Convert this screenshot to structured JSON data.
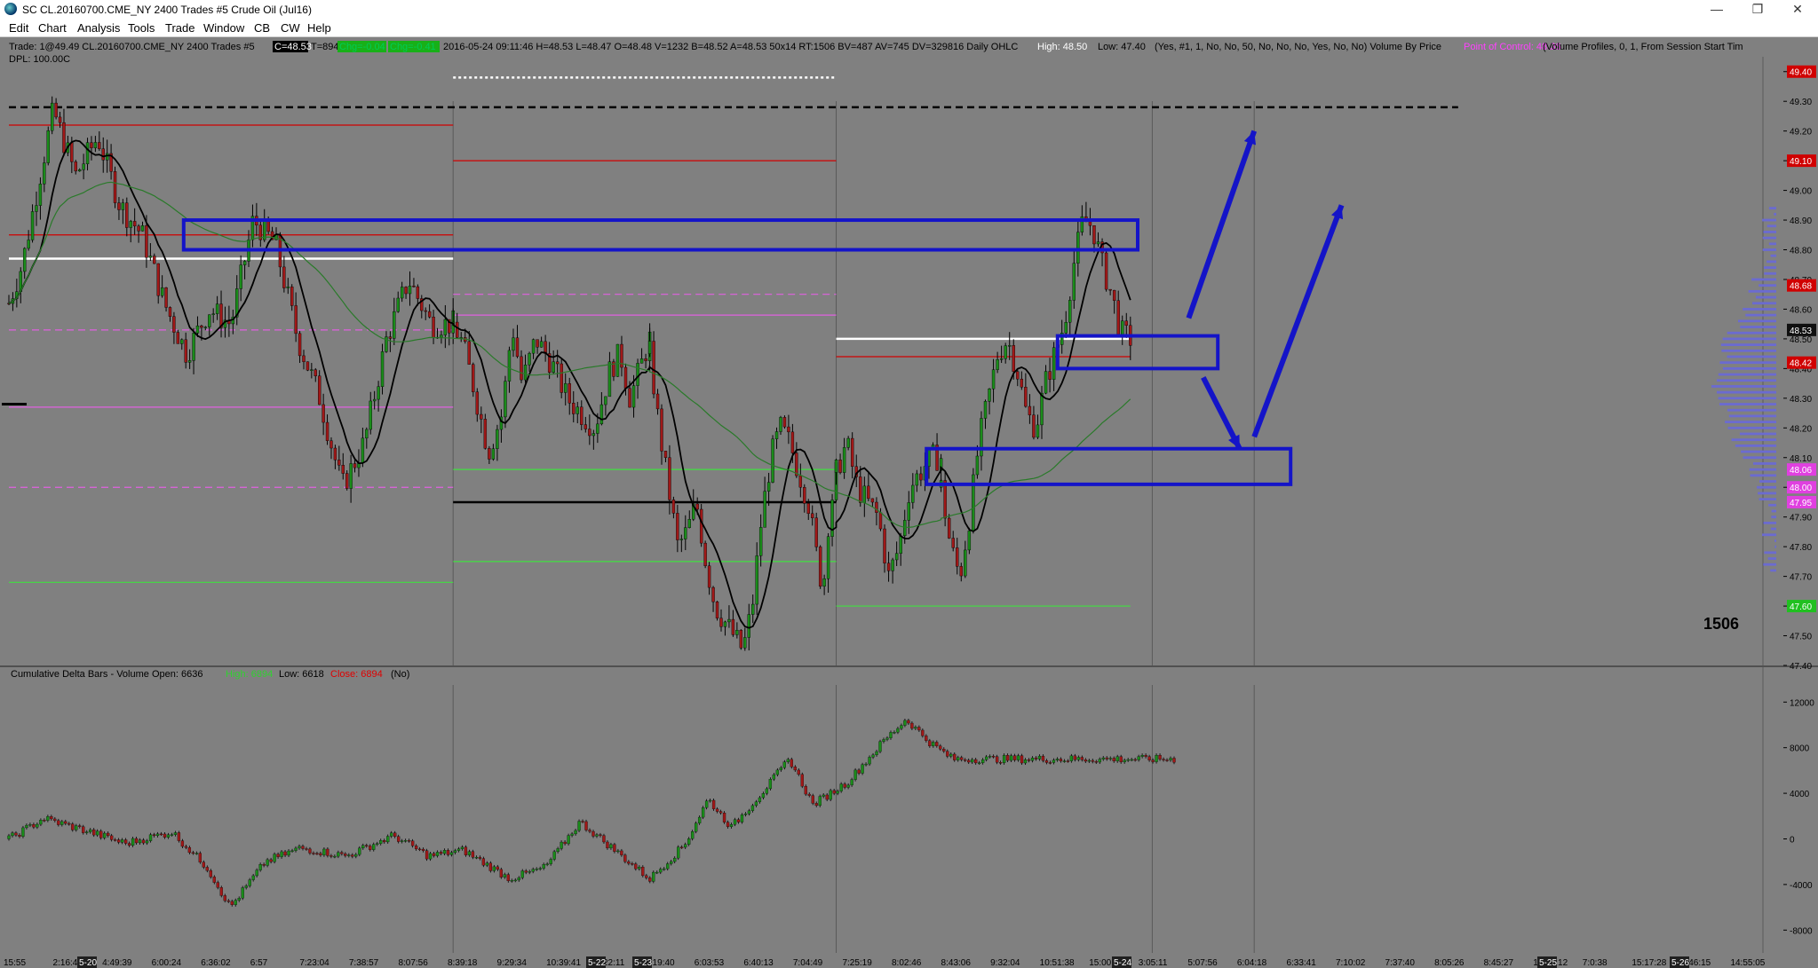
{
  "window": {
    "title": "SC CL.20160700.CME_NY  2400 Trades  #5  Crude Oil (Jul16)",
    "controls": {
      "minimize": "—",
      "restore": "❐",
      "close": "✕"
    }
  },
  "menu": [
    "Edit",
    "Chart",
    "Analysis",
    "Tools",
    "Trade",
    "Window",
    "CB",
    "CW",
    "Help"
  ],
  "header": {
    "line1_prefix": "Trade: 1@49.49  CL.20160700.CME_NY  2400 Trades  #5",
    "last_price_badge": "C=48.53",
    "trades": "T=894",
    "green_badge_1": "Chg=-0.04",
    "green_badge_2": "Chg=-0.41",
    "line1_body": "2016-05-24 09:11:46  H=48.53  L=48.47  O=48.48  V=1232  B=48.52  A=48.53  50x14  RT:1506  BV=487  AV=745  DV=329816  Daily OHLC",
    "high_label": "High: 48.50",
    "low_label": "Low: 47.40",
    "study_params": "(Yes, #1, 1, No, No, 50, No, No, No, Yes, No, No)  Volume By Price",
    "poc_label": "Point of Control: 48.36",
    "profile_params": "(Volume Profiles, 0, 1, From Session Start Tim",
    "line2": "DPL: 100.00C"
  },
  "price_axis": {
    "ticks": [
      49.4,
      49.3,
      49.2,
      49.1,
      49.0,
      48.9,
      48.8,
      48.7,
      48.6,
      48.5,
      48.4,
      48.3,
      48.2,
      48.1,
      48.0,
      47.9,
      47.8,
      47.7,
      47.6,
      47.5,
      47.4
    ],
    "tags": [
      {
        "label": "49.40",
        "value": 49.4,
        "color": "#d00000"
      },
      {
        "label": "49.10",
        "value": 49.1,
        "color": "#d00000"
      },
      {
        "label": "48.68",
        "value": 48.68,
        "color": "#d00000"
      },
      {
        "label": "48.53",
        "value": 48.53,
        "color": "#101010"
      },
      {
        "label": "48.42",
        "value": 48.42,
        "color": "#d00000"
      },
      {
        "label": "48.06",
        "value": 48.06,
        "color": "#e040e0"
      },
      {
        "label": "48.00",
        "value": 48.0,
        "color": "#e040e0"
      },
      {
        "label": "47.95",
        "value": 47.95,
        "color": "#e040e0"
      },
      {
        "label": "47.60",
        "value": 47.6,
        "color": "#20c020"
      }
    ]
  },
  "lower_pane": {
    "title_prefix": "Cumulative Delta Bars - Volume  Open: 6636",
    "high_label": "High: 6894",
    "low_label": "Low: 6618",
    "close_label": "Close: 6894",
    "suffix": "(No)",
    "axis_ticks": [
      12000,
      8000,
      4000,
      0,
      -4000,
      -8000
    ]
  },
  "annotation": {
    "bar_count": "1506"
  },
  "time_axis": {
    "labels": [
      "15:55",
      "2:16:46",
      "4:49:39",
      "6:00:24",
      "6:36:02",
      "6:57",
      "7:23:04",
      "7:38:57",
      "8:07:56",
      "8:39:18",
      "9:29:34",
      "10:39:41",
      "2:22:11",
      "5:19:40",
      "6:03:53",
      "6:40:13",
      "7:04:49",
      "7:25:19",
      "8:02:46",
      "8:43:06",
      "9:32:04",
      "10:51:38",
      "15:00",
      "3:05:11",
      "5:07:56",
      "6:04:18",
      "6:33:41",
      "7:10:02",
      "7:37:40",
      "8:05:26",
      "8:45:27",
      "13:13:12",
      "7:0:38",
      "15:17:28",
      "6:46:15",
      "14:55:05"
    ],
    "date_badges": [
      "5-20",
      "5-22",
      "5-23",
      "5-24",
      "5-25",
      "5-26"
    ]
  },
  "chart_data": {
    "type": "candlestick",
    "instrument": "CL.20160700.CME_NY",
    "bar_type": "2400 Trades",
    "ylim": [
      47.4,
      49.45
    ],
    "sessions": [
      {
        "label": "5-20",
        "path": [
          [
            0,
            48.62
          ],
          [
            0.03,
            48.75
          ],
          [
            0.07,
            49.05
          ],
          [
            0.1,
            49.27
          ],
          [
            0.15,
            49.05
          ],
          [
            0.2,
            49.18
          ],
          [
            0.25,
            48.95
          ],
          [
            0.3,
            48.85
          ],
          [
            0.35,
            48.62
          ],
          [
            0.4,
            48.45
          ],
          [
            0.45,
            48.6
          ],
          [
            0.5,
            48.55
          ],
          [
            0.55,
            48.9
          ],
          [
            0.6,
            48.82
          ],
          [
            0.65,
            48.5
          ],
          [
            0.7,
            48.3
          ],
          [
            0.75,
            48.0
          ],
          [
            0.8,
            48.15
          ],
          [
            0.85,
            48.5
          ],
          [
            0.9,
            48.7
          ],
          [
            0.95,
            48.55
          ],
          [
            1.0,
            48.55
          ]
        ]
      },
      {
        "label": "5-22",
        "path": [
          [
            0,
            48.55
          ],
          [
            0.05,
            48.48
          ],
          [
            0.1,
            48.35
          ],
          [
            0.18,
            48.12
          ],
          [
            0.25,
            48.25
          ],
          [
            0.3,
            48.55
          ],
          [
            0.35,
            48.35
          ],
          [
            0.42,
            48.5
          ],
          [
            0.5,
            48.42
          ],
          [
            0.58,
            48.3
          ],
          [
            0.65,
            48.25
          ],
          [
            0.72,
            48.2
          ],
          [
            0.8,
            48.4
          ],
          [
            0.85,
            48.45
          ],
          [
            0.9,
            48.3
          ],
          [
            0.95,
            48.4
          ],
          [
            1.0,
            48.5
          ]
        ]
      },
      {
        "label": "5-23",
        "path": [
          [
            0,
            48.45
          ],
          [
            0.05,
            48.2
          ],
          [
            0.1,
            48.0
          ],
          [
            0.15,
            47.8
          ],
          [
            0.2,
            47.85
          ],
          [
            0.25,
            47.95
          ],
          [
            0.3,
            47.75
          ],
          [
            0.35,
            47.6
          ],
          [
            0.4,
            47.55
          ],
          [
            0.45,
            47.5
          ],
          [
            0.5,
            47.45
          ],
          [
            0.55,
            47.6
          ],
          [
            0.6,
            47.9
          ],
          [
            0.65,
            48.1
          ],
          [
            0.7,
            48.2
          ],
          [
            0.75,
            48.15
          ],
          [
            0.8,
            48.05
          ],
          [
            0.85,
            47.95
          ],
          [
            0.9,
            47.75
          ],
          [
            0.93,
            47.65
          ],
          [
            0.96,
            47.9
          ],
          [
            1.0,
            48.05
          ]
        ]
      },
      {
        "label": "5-23b",
        "path": [
          [
            0,
            48.05
          ],
          [
            0.1,
            48.15
          ],
          [
            0.2,
            48.0
          ],
          [
            0.3,
            47.95
          ],
          [
            0.4,
            47.9
          ],
          [
            0.5,
            47.7
          ],
          [
            0.6,
            47.8
          ],
          [
            0.7,
            48.0
          ],
          [
            0.8,
            48.05
          ],
          [
            0.9,
            48.1
          ],
          [
            1.0,
            48.1
          ]
        ]
      },
      {
        "label": "5-24",
        "path": [
          [
            0,
            48.0
          ],
          [
            0.05,
            47.8
          ],
          [
            0.1,
            47.7
          ],
          [
            0.15,
            47.9
          ],
          [
            0.2,
            48.15
          ],
          [
            0.25,
            48.3
          ],
          [
            0.3,
            48.45
          ],
          [
            0.35,
            48.5
          ],
          [
            0.4,
            48.4
          ],
          [
            0.45,
            48.25
          ],
          [
            0.5,
            48.2
          ],
          [
            0.55,
            48.35
          ],
          [
            0.6,
            48.45
          ],
          [
            0.65,
            48.55
          ],
          [
            0.7,
            48.75
          ],
          [
            0.75,
            48.9
          ],
          [
            0.8,
            48.88
          ],
          [
            0.85,
            48.75
          ],
          [
            0.9,
            48.65
          ],
          [
            0.95,
            48.52
          ],
          [
            1.0,
            48.5
          ]
        ]
      }
    ],
    "horizontal_levels": [
      {
        "value": 49.28,
        "style": "dashed",
        "color": "#000000",
        "span": "all"
      },
      {
        "value": 49.38,
        "style": "dotted",
        "color": "#ffffff",
        "span": "s2"
      },
      {
        "value": 49.22,
        "style": "solid",
        "color": "#d00000",
        "span": "s1"
      },
      {
        "value": 49.1,
        "style": "solid",
        "color": "#d00000",
        "span": "s2"
      },
      {
        "value": 48.85,
        "style": "solid",
        "color": "#d00000",
        "span": "s1"
      },
      {
        "value": 48.77,
        "style": "solid",
        "color": "#ffffff",
        "span": "s1"
      },
      {
        "value": 48.65,
        "style": "dashed",
        "color": "#e060e0",
        "span": "s2"
      },
      {
        "value": 48.58,
        "style": "solid",
        "color": "#e060e0",
        "span": "s2"
      },
      {
        "value": 48.53,
        "style": "dashed",
        "color": "#e060e0",
        "span": "s1"
      },
      {
        "value": 48.5,
        "style": "solid",
        "color": "#ffffff",
        "span": "s3"
      },
      {
        "value": 48.44,
        "style": "solid",
        "color": "#d00000",
        "span": "s3"
      },
      {
        "value": 48.27,
        "style": "solid",
        "color": "#e060e0",
        "span": "s1"
      },
      {
        "value": 48.06,
        "style": "solid",
        "color": "#40e040",
        "span": "s2"
      },
      {
        "value": 48.0,
        "style": "dashed",
        "color": "#e060e0",
        "span": "s1"
      },
      {
        "value": 47.95,
        "style": "solid",
        "color": "#000000",
        "span": "s2"
      },
      {
        "value": 47.75,
        "style": "solid",
        "color": "#40e040",
        "span": "s2"
      },
      {
        "value": 47.68,
        "style": "solid",
        "color": "#40e040",
        "span": "s1"
      },
      {
        "value": 47.6,
        "style": "solid",
        "color": "#40e040",
        "span": "s3"
      }
    ],
    "boxes": [
      {
        "name": "resistance-box",
        "x0": 0.12,
        "x1": 0.775,
        "y0": 48.9,
        "y1": 48.8
      },
      {
        "name": "support-box-1",
        "x0": 0.72,
        "x1": 0.83,
        "y0": 48.51,
        "y1": 48.4
      },
      {
        "name": "support-box-2",
        "x0": 0.63,
        "x1": 0.88,
        "y0": 48.13,
        "y1": 48.01
      }
    ],
    "arrows": [
      {
        "x0": 0.81,
        "y0": 48.57,
        "x1": 0.855,
        "y1": 49.2
      },
      {
        "x0": 0.82,
        "y0": 48.37,
        "x1": 0.845,
        "y1": 48.13
      },
      {
        "x0": 0.855,
        "y0": 48.17,
        "x1": 0.915,
        "y1": 48.95
      }
    ],
    "delta_ylim": [
      -10000,
      13500
    ],
    "delta_path": [
      [
        0,
        0
      ],
      [
        0.03,
        1800
      ],
      [
        0.07,
        600
      ],
      [
        0.1,
        -400
      ],
      [
        0.14,
        600
      ],
      [
        0.17,
        -2500
      ],
      [
        0.19,
        -6000
      ],
      [
        0.22,
        -2000
      ],
      [
        0.25,
        -800
      ],
      [
        0.29,
        -1500
      ],
      [
        0.33,
        300
      ],
      [
        0.36,
        -1500
      ],
      [
        0.39,
        -1000
      ],
      [
        0.43,
        -3500
      ],
      [
        0.46,
        -2500
      ],
      [
        0.49,
        1500
      ],
      [
        0.52,
        -1000
      ],
      [
        0.55,
        -3500
      ],
      [
        0.58,
        -500
      ],
      [
        0.6,
        3500
      ],
      [
        0.62,
        1000
      ],
      [
        0.65,
        4500
      ],
      [
        0.67,
        7000
      ],
      [
        0.69,
        3000
      ],
      [
        0.72,
        5000
      ],
      [
        0.75,
        8500
      ],
      [
        0.77,
        10500
      ],
      [
        0.79,
        8500
      ],
      [
        0.81,
        7000
      ],
      [
        0.82,
        7000
      ]
    ]
  }
}
